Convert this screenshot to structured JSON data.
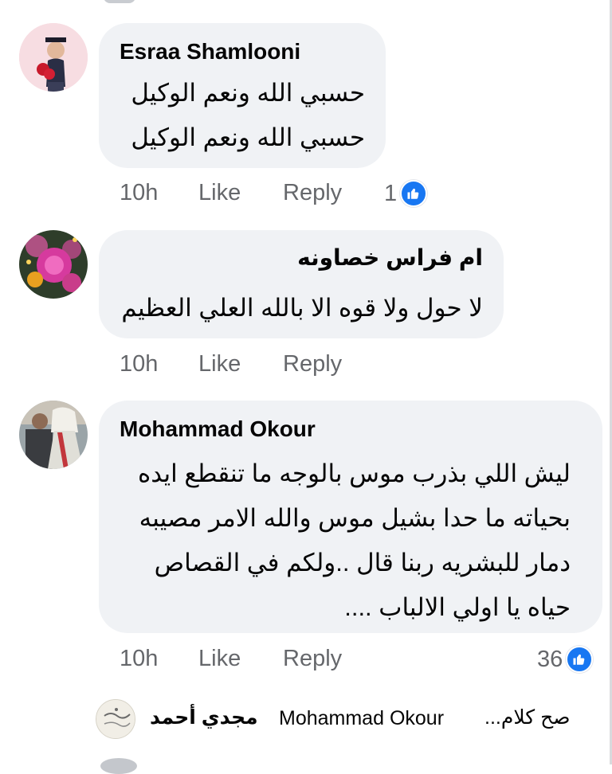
{
  "comments": [
    {
      "author": "Esraa Shamlooni",
      "lines": [
        "حسبي الله ونعم الوكيل",
        "حسبي الله ونعم الوكيل"
      ],
      "time": "10h",
      "like_label": "Like",
      "reply_label": "Reply",
      "reaction_count": "1",
      "reaction_icon": "like-icon"
    },
    {
      "author": "ام فراس خصاونه",
      "lines": [
        "لا حول ولا قوه الا بالله العلي العظيم"
      ],
      "time": "10h",
      "like_label": "Like",
      "reply_label": "Reply"
    },
    {
      "author": "Mohammad Okour",
      "lines": [
        "ليش اللي بذرب موس بالوجه ما تنقطع ايده",
        "بحياته ما حدا بشيل موس والله الامر مصيبه",
        "دمار للبشريه ربنا قال ..ولكم في القصاص",
        "حياه يا اولي الالباب ...."
      ],
      "time": "10h",
      "like_label": "Like",
      "reply_label": "Reply",
      "reaction_count": "36",
      "reaction_icon": "like-icon"
    }
  ],
  "reply_preview": {
    "author": "مجدي أحمد",
    "mention": "Mohammad Okour",
    "text": "صح كلام..."
  },
  "colors": {
    "bubble": "#f0f2f5",
    "meta_text": "#65676b",
    "like_blue": "#1877f2"
  }
}
